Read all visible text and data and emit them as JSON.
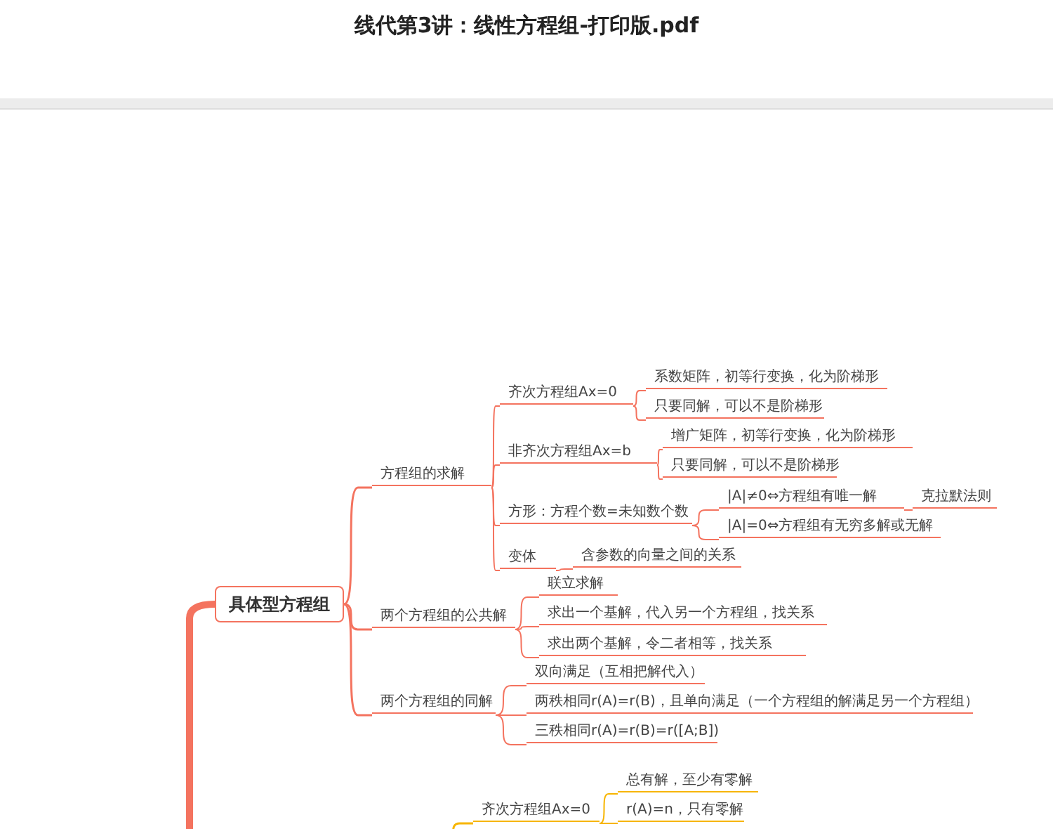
{
  "document": {
    "title": "线代第3讲：线性方程组-打印版.pdf"
  },
  "mindmap": {
    "topics": [
      {
        "label": "具体型方程组",
        "color": "#f4735f",
        "children": [
          {
            "label": "方程组的求解",
            "children": [
              {
                "label": "齐次方程组Ax=0",
                "children": [
                  {
                    "label": "系数矩阵，初等行变换，化为阶梯形"
                  },
                  {
                    "label": "只要同解，可以不是阶梯形"
                  }
                ]
              },
              {
                "label": "非齐次方程组Ax=b",
                "children": [
                  {
                    "label": "增广矩阵，初等行变换，化为阶梯形"
                  },
                  {
                    "label": "只要同解，可以不是阶梯形"
                  }
                ]
              },
              {
                "label": "方形：方程个数=未知数个数",
                "children": [
                  {
                    "label": "|A|≠0⇔方程组有唯一解",
                    "children": [
                      {
                        "label": "克拉默法则"
                      }
                    ]
                  },
                  {
                    "label": "|A|=0⇔方程组有无穷多解或无解"
                  }
                ]
              },
              {
                "label": "变体",
                "children": [
                  {
                    "label": "含参数的向量之间的关系"
                  }
                ]
              }
            ]
          },
          {
            "label": "两个方程组的公共解",
            "children": [
              {
                "label": "联立求解"
              },
              {
                "label": "求出一个基解，代入另一个方程组，找关系"
              },
              {
                "label": "求出两个基解，令二者相等，找关系"
              }
            ]
          },
          {
            "label": "两个方程组的同解",
            "children": [
              {
                "label": "双向满足（互相把解代入）"
              },
              {
                "label": "两秩相同r(A)=r(B)，且单向满足（一个方程组的解满足另一个方程组）"
              },
              {
                "label": "三秩相同r(A)=r(B)=r([A;B])"
              }
            ]
          }
        ]
      },
      {
        "color": "#f7b500",
        "children": [
          {
            "label": "齐次方程组Ax=0",
            "children": [
              {
                "label": "总有解，至少有零解"
              },
              {
                "label": "r(A)=n，只有零解"
              }
            ]
          }
        ]
      }
    ]
  }
}
